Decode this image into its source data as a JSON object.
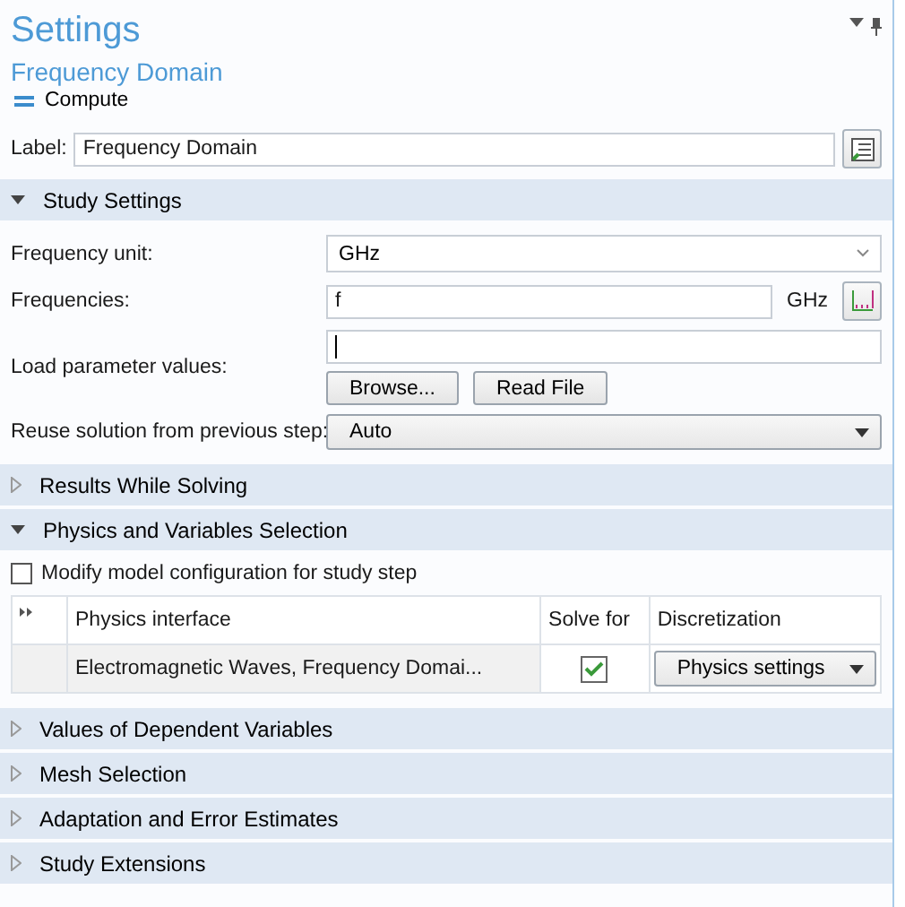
{
  "window": {
    "title": "Settings"
  },
  "subtitle": "Frequency Domain",
  "compute_button": {
    "label": "Compute"
  },
  "label_field": {
    "label": "Label:",
    "value": "Frequency Domain"
  },
  "sections": [
    {
      "title": "Study Settings",
      "expanded": true,
      "content": {
        "kind": "study",
        "rows": [
          {
            "kind": "select",
            "label": "Frequency unit:",
            "value": "GHz"
          },
          {
            "kind": "unit_input",
            "label": "Frequencies:",
            "value": "f",
            "unit": "GHz"
          },
          {
            "kind": "file",
            "label": "Load parameter values:",
            "buttons": [
              "Browse...",
              "Read File"
            ]
          },
          {
            "kind": "dropdown",
            "label": "Reuse solution from previous step:",
            "value": "Auto"
          }
        ]
      }
    },
    {
      "title": "Results While Solving",
      "expanded": false
    },
    {
      "title": "Physics and Variables Selection",
      "expanded": true,
      "content": {
        "kind": "physics",
        "checkbox": {
          "label": "Modify model configuration for study step",
          "checked": false
        },
        "columns": [
          "Physics interface",
          "Solve for",
          "Discretization"
        ],
        "rows": [
          {
            "interface": "Electromagnetic Waves, Frequency Domai...",
            "solve_for": true,
            "discretization": "Physics settings"
          }
        ]
      }
    },
    {
      "title": "Values of Dependent Variables",
      "expanded": false
    },
    {
      "title": "Mesh Selection",
      "expanded": false
    },
    {
      "title": "Adaptation and Error Estimates",
      "expanded": false
    },
    {
      "title": "Study Extensions",
      "expanded": false
    }
  ]
}
